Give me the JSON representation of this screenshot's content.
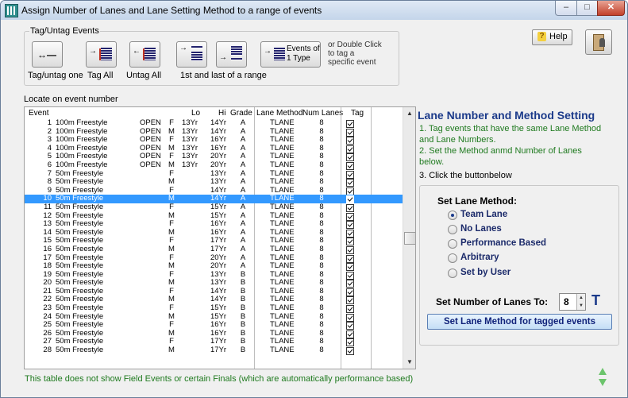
{
  "window": {
    "title": "Assign Number of Lanes and Lane Setting Method to a range of events"
  },
  "tag_group": {
    "legend": "Tag/Untag Events",
    "buttons": {
      "tag_untag_one": "Tag/untag one",
      "tag_all": "Tag All",
      "untag_all": "Untag All",
      "range": "1st and last of a range",
      "events_line1": "Events of",
      "events_line2": "1 Type"
    },
    "hint_line1": "or Double Click",
    "hint_line2": "to tag a",
    "hint_line3": "specific event"
  },
  "help_label": "Help",
  "locate_label": "Locate on event number",
  "table": {
    "headers": {
      "event": "Event",
      "lo": "Lo",
      "hi": "Hi",
      "grade": "Grade",
      "method": "Lane Method",
      "num": "Num Lanes",
      "tag": "Tag"
    },
    "selected_row": 9,
    "rows": [
      {
        "num": "1",
        "name": "100m Freestyle",
        "open": "OPEN",
        "gender": "F",
        "lo": "13Yr",
        "hi": "14Yr",
        "grade": "A",
        "method": "TLANE",
        "lanes": "8",
        "tag": true
      },
      {
        "num": "2",
        "name": "100m Freestyle",
        "open": "OPEN",
        "gender": "M",
        "lo": "13Yr",
        "hi": "14Yr",
        "grade": "A",
        "method": "TLANE",
        "lanes": "8",
        "tag": true
      },
      {
        "num": "3",
        "name": "100m Freestyle",
        "open": "OPEN",
        "gender": "F",
        "lo": "13Yr",
        "hi": "16Yr",
        "grade": "A",
        "method": "TLANE",
        "lanes": "8",
        "tag": true
      },
      {
        "num": "4",
        "name": "100m Freestyle",
        "open": "OPEN",
        "gender": "M",
        "lo": "13Yr",
        "hi": "16Yr",
        "grade": "A",
        "method": "TLANE",
        "lanes": "8",
        "tag": true
      },
      {
        "num": "5",
        "name": "100m Freestyle",
        "open": "OPEN",
        "gender": "F",
        "lo": "13Yr",
        "hi": "20Yr",
        "grade": "A",
        "method": "TLANE",
        "lanes": "8",
        "tag": true
      },
      {
        "num": "6",
        "name": "100m Freestyle",
        "open": "OPEN",
        "gender": "M",
        "lo": "13Yr",
        "hi": "20Yr",
        "grade": "A",
        "method": "TLANE",
        "lanes": "8",
        "tag": true
      },
      {
        "num": "7",
        "name": "50m Freestyle",
        "open": "",
        "gender": "F",
        "lo": "",
        "hi": "13Yr",
        "grade": "A",
        "method": "TLANE",
        "lanes": "8",
        "tag": true
      },
      {
        "num": "8",
        "name": "50m Freestyle",
        "open": "",
        "gender": "M",
        "lo": "",
        "hi": "13Yr",
        "grade": "A",
        "method": "TLANE",
        "lanes": "8",
        "tag": true
      },
      {
        "num": "9",
        "name": "50m Freestyle",
        "open": "",
        "gender": "F",
        "lo": "",
        "hi": "14Yr",
        "grade": "A",
        "method": "TLANE",
        "lanes": "8",
        "tag": true
      },
      {
        "num": "10",
        "name": "50m Freestyle",
        "open": "",
        "gender": "M",
        "lo": "",
        "hi": "14Yr",
        "grade": "A",
        "method": "TLANE",
        "lanes": "8",
        "tag": true
      },
      {
        "num": "11",
        "name": "50m Freestyle",
        "open": "",
        "gender": "F",
        "lo": "",
        "hi": "15Yr",
        "grade": "A",
        "method": "TLANE",
        "lanes": "8",
        "tag": true
      },
      {
        "num": "12",
        "name": "50m Freestyle",
        "open": "",
        "gender": "M",
        "lo": "",
        "hi": "15Yr",
        "grade": "A",
        "method": "TLANE",
        "lanes": "8",
        "tag": true
      },
      {
        "num": "13",
        "name": "50m Freestyle",
        "open": "",
        "gender": "F",
        "lo": "",
        "hi": "16Yr",
        "grade": "A",
        "method": "TLANE",
        "lanes": "8",
        "tag": true
      },
      {
        "num": "14",
        "name": "50m Freestyle",
        "open": "",
        "gender": "M",
        "lo": "",
        "hi": "16Yr",
        "grade": "A",
        "method": "TLANE",
        "lanes": "8",
        "tag": true
      },
      {
        "num": "15",
        "name": "50m Freestyle",
        "open": "",
        "gender": "F",
        "lo": "",
        "hi": "17Yr",
        "grade": "A",
        "method": "TLANE",
        "lanes": "8",
        "tag": true
      },
      {
        "num": "16",
        "name": "50m Freestyle",
        "open": "",
        "gender": "M",
        "lo": "",
        "hi": "17Yr",
        "grade": "A",
        "method": "TLANE",
        "lanes": "8",
        "tag": true
      },
      {
        "num": "17",
        "name": "50m Freestyle",
        "open": "",
        "gender": "F",
        "lo": "",
        "hi": "20Yr",
        "grade": "A",
        "method": "TLANE",
        "lanes": "8",
        "tag": true
      },
      {
        "num": "18",
        "name": "50m Freestyle",
        "open": "",
        "gender": "M",
        "lo": "",
        "hi": "20Yr",
        "grade": "A",
        "method": "TLANE",
        "lanes": "8",
        "tag": true
      },
      {
        "num": "19",
        "name": "50m Freestyle",
        "open": "",
        "gender": "F",
        "lo": "",
        "hi": "13Yr",
        "grade": "B",
        "method": "TLANE",
        "lanes": "8",
        "tag": true
      },
      {
        "num": "20",
        "name": "50m Freestyle",
        "open": "",
        "gender": "M",
        "lo": "",
        "hi": "13Yr",
        "grade": "B",
        "method": "TLANE",
        "lanes": "8",
        "tag": true
      },
      {
        "num": "21",
        "name": "50m Freestyle",
        "open": "",
        "gender": "F",
        "lo": "",
        "hi": "14Yr",
        "grade": "B",
        "method": "TLANE",
        "lanes": "8",
        "tag": true
      },
      {
        "num": "22",
        "name": "50m Freestyle",
        "open": "",
        "gender": "M",
        "lo": "",
        "hi": "14Yr",
        "grade": "B",
        "method": "TLANE",
        "lanes": "8",
        "tag": true
      },
      {
        "num": "23",
        "name": "50m Freestyle",
        "open": "",
        "gender": "F",
        "lo": "",
        "hi": "15Yr",
        "grade": "B",
        "method": "TLANE",
        "lanes": "8",
        "tag": true
      },
      {
        "num": "24",
        "name": "50m Freestyle",
        "open": "",
        "gender": "M",
        "lo": "",
        "hi": "15Yr",
        "grade": "B",
        "method": "TLANE",
        "lanes": "8",
        "tag": true
      },
      {
        "num": "25",
        "name": "50m Freestyle",
        "open": "",
        "gender": "F",
        "lo": "",
        "hi": "16Yr",
        "grade": "B",
        "method": "TLANE",
        "lanes": "8",
        "tag": true
      },
      {
        "num": "26",
        "name": "50m Freestyle",
        "open": "",
        "gender": "M",
        "lo": "",
        "hi": "16Yr",
        "grade": "B",
        "method": "TLANE",
        "lanes": "8",
        "tag": true
      },
      {
        "num": "27",
        "name": "50m Freestyle",
        "open": "",
        "gender": "F",
        "lo": "",
        "hi": "17Yr",
        "grade": "B",
        "method": "TLANE",
        "lanes": "8",
        "tag": true
      },
      {
        "num": "28",
        "name": "50m Freestyle",
        "open": "",
        "gender": "M",
        "lo": "",
        "hi": "17Yr",
        "grade": "B",
        "method": "TLANE",
        "lanes": "8",
        "tag": true
      }
    ]
  },
  "right_panel": {
    "title": "Lane Number and Method Setting",
    "instructions": [
      "1. Tag events that have the same Lane Method",
      "and Lane Numbers.",
      "2. Set the Method anmd Number of Lanes",
      "below.",
      "3.  Click the buttonbelow"
    ],
    "method_title": "Set Lane Method:",
    "methods": [
      {
        "label": "Team Lane",
        "selected": true
      },
      {
        "label": "No Lanes",
        "selected": false
      },
      {
        "label": "Performance Based",
        "selected": false
      },
      {
        "label": "Arbitrary",
        "selected": false
      },
      {
        "label": "Set by User",
        "selected": false
      }
    ],
    "lanes_label": "Set Number of Lanes To:",
    "lanes_value": "8",
    "t_mark": "T",
    "set_button": "Set Lane Method for tagged events"
  },
  "footnote": "This table does not show Field Events or certain Finals (which are automatically performance based)",
  "colors": {
    "accent": "#1b3a8a",
    "instructions": "#1f7a1f",
    "selection": "#3399ff"
  }
}
